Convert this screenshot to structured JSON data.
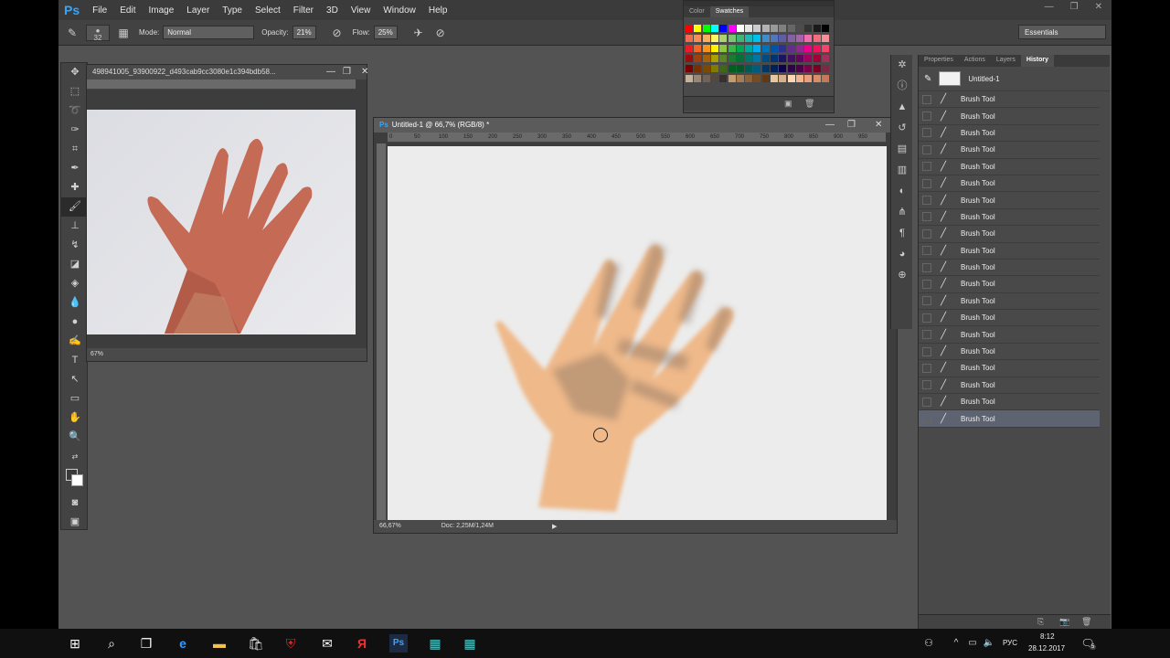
{
  "app": {
    "logo": "Ps",
    "menu": [
      "File",
      "Edit",
      "Image",
      "Layer",
      "Type",
      "Select",
      "Filter",
      "3D",
      "View",
      "Window",
      "Help"
    ],
    "workspace": "Essentials"
  },
  "options": {
    "brush_size": "32",
    "mode_label": "Mode:",
    "mode_value": "Normal",
    "opacity_label": "Opacity:",
    "opacity_value": "21%",
    "flow_label": "Flow:",
    "flow_value": "25%"
  },
  "ref_doc": {
    "title": "498941005_93900922_d493cab9cc3080e1c394bdb58...",
    "zoom": "67%"
  },
  "main_doc": {
    "title": "Untitled-1 @ 66,7% (RGB/8) *",
    "zoom": "66,67%",
    "doc_info": "Doc: 2,25M/1,24M",
    "ruler_marks": [
      "0",
      "50",
      "100",
      "150",
      "200",
      "250",
      "300",
      "350",
      "400",
      "450",
      "500",
      "550",
      "600",
      "650",
      "700",
      "750",
      "800",
      "850",
      "900",
      "950"
    ]
  },
  "swatch_panel": {
    "tabs": [
      "Color",
      "Swatches"
    ],
    "active_tab": "Swatches"
  },
  "history_panel": {
    "tabs": [
      "Properties",
      "Actions",
      "Layers",
      "History"
    ],
    "active_tab": "History",
    "snapshot": "Untitled-1",
    "items": [
      "Brush Tool",
      "Brush Tool",
      "Brush Tool",
      "Brush Tool",
      "Brush Tool",
      "Brush Tool",
      "Brush Tool",
      "Brush Tool",
      "Brush Tool",
      "Brush Tool",
      "Brush Tool",
      "Brush Tool",
      "Brush Tool",
      "Brush Tool",
      "Brush Tool",
      "Brush Tool",
      "Brush Tool",
      "Brush Tool",
      "Brush Tool",
      "Brush Tool"
    ]
  },
  "taskbar": {
    "lang": "РУС",
    "time": "8:12",
    "date": "28.12.2017",
    "notifications": "5"
  }
}
